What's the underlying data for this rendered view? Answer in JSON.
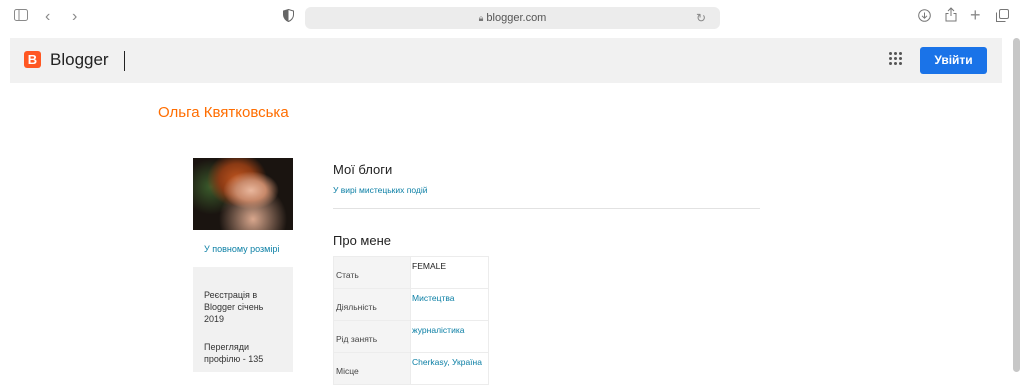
{
  "browser": {
    "url": "blogger.com",
    "icons": [
      "sidebar-icon",
      "back-icon",
      "forward-icon",
      "privacy-shield-icon",
      "lock-icon",
      "reload-icon",
      "download-icon",
      "share-icon",
      "new-tab-icon",
      "tabs-overview-icon"
    ]
  },
  "header": {
    "logo_letter": "B",
    "brand": "Blogger",
    "signin_label": "Увійти",
    "accent_color": "#ff5722",
    "button_color": "#1a73e8"
  },
  "profile": {
    "name": "Ольга Квятковська",
    "fullsize_link": "У повному розмірі",
    "registration": "Реєстрація в Blogger січень 2019",
    "views": "Перегляди профілю - 135"
  },
  "blogs": {
    "heading": "Мої блоги",
    "items": [
      "У вирі мистецьких подій"
    ]
  },
  "about": {
    "heading": "Про мене",
    "rows": [
      {
        "label": "Стать",
        "value": "FEMALE",
        "link": false
      },
      {
        "label": "Діяльність",
        "value": "Мистецтва",
        "link": true
      },
      {
        "label": "Рід занять",
        "value": "журналістика",
        "link": true
      },
      {
        "label": "Місце",
        "value": "Cherkasy, Україна",
        "link": true
      }
    ]
  }
}
